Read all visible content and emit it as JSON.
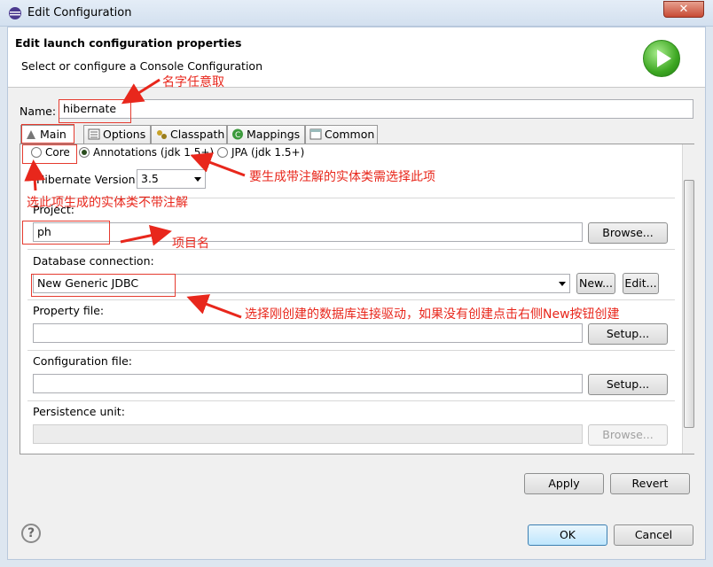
{
  "window": {
    "title": "Edit Configuration",
    "close_label": "✕"
  },
  "header": {
    "title": "Edit launch configuration properties",
    "subtitle": "Select or configure a Console Configuration"
  },
  "name": {
    "label": "Name:",
    "value": "hibernate"
  },
  "tabs": [
    {
      "label": "Main",
      "icon": "main-tab-icon"
    },
    {
      "label": "Options",
      "icon": "options-tab-icon"
    },
    {
      "label": "Classpath",
      "icon": "classpath-tab-icon"
    },
    {
      "label": "Mappings",
      "icon": "mappings-tab-icon"
    },
    {
      "label": "Common",
      "icon": "common-tab-icon"
    }
  ],
  "main": {
    "mode_options": [
      {
        "label": "Core",
        "selected": false
      },
      {
        "label": "Annotations (jdk 1.5+)",
        "selected": true
      },
      {
        "label": "JPA (jdk 1.5+)",
        "selected": false
      }
    ],
    "hibernate_version_label": "Hibernate Version:",
    "hibernate_version_value": "3.5",
    "project_label": "Project:",
    "project_value": "ph",
    "browse_label": "Browse...",
    "db_label": "Database connection:",
    "db_value": "New Generic JDBC",
    "new_label": "New...",
    "edit_label": "Edit...",
    "property_label": "Property file:",
    "property_value": "",
    "setup_label": "Setup...",
    "config_label": "Configuration file:",
    "config_value": "",
    "setup2_label": "Setup...",
    "persistence_label": "Persistence unit:",
    "persistence_value": "",
    "browse2_label": "Browse..."
  },
  "buttons": {
    "apply": "Apply",
    "revert": "Revert",
    "ok": "OK",
    "cancel": "Cancel",
    "help": "?"
  },
  "annotations": {
    "name_note": "名字任意取",
    "annotations_note": "要生成带注解的实体类需选择此项",
    "core_note": "选此项生成的实体类不带注解",
    "project_note": "项目名",
    "db_note": "选择刚创建的数据库连接驱动，如果没有创建点击右侧New按钮创建"
  },
  "colors": {
    "annotation": "#e8271c",
    "default_button": "#3c7fb1"
  }
}
